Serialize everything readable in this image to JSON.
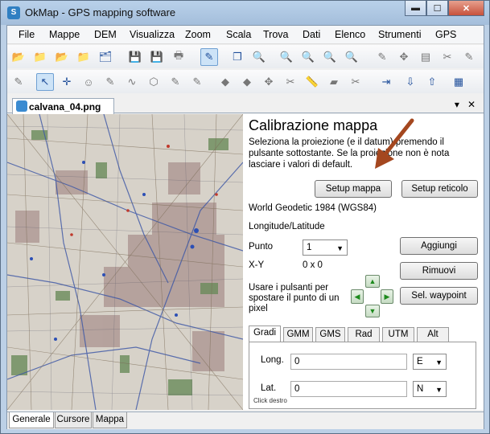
{
  "window": {
    "title": "OkMap - GPS mapping software",
    "min_glyph": "▬",
    "max_glyph": "☐",
    "close_glyph": "✕"
  },
  "menu": [
    "File",
    "Mappe",
    "DEM",
    "Visualizza",
    "Zoom",
    "Scala",
    "Trova",
    "Dati",
    "Elenco",
    "Strumenti",
    "GPS"
  ],
  "document_tab": {
    "label": "calvana_04.png",
    "dropdown": "▾",
    "close": "✕"
  },
  "panel": {
    "title": "Calibrazione mappa",
    "description": "Seleziona la proiezione (e il datum) premendo il pulsante sottostante. Se la proiezione non è nota lasciare i valori di default.",
    "setup_map_button": "Setup mappa",
    "setup_grid_button": "Setup reticolo",
    "datum": "World Geodetic 1984 (WGS84)",
    "projection": "Longitude/Latitude",
    "point_label": "Punto",
    "point_value": "1",
    "add_button": "Aggiungi",
    "xy_label": "X-Y",
    "xy_value": "0 x 0",
    "remove_button": "Rimuovi",
    "move_hint": "Usare i pulsanti per spostare il punto di un pixel",
    "waypoint_button": "Sel. waypoint",
    "coord_tabs": [
      "Gradi",
      "GMM",
      "GMS",
      "Rad",
      "UTM",
      "Alt"
    ],
    "active_coord_tab": "Gradi",
    "long_label": "Long.",
    "long_value": "0",
    "long_dir": "E",
    "lat_label": "Lat.",
    "lat_value": "0",
    "lat_dir": "N",
    "click_hint": "Click destro"
  },
  "bottom_tabs": [
    "Generale",
    "Cursore",
    "Mappa"
  ],
  "active_bottom_tab": "Generale",
  "colors": {
    "annotation_arrow": "#a4471f",
    "nav_arrow_green": "#1c8a1c"
  }
}
